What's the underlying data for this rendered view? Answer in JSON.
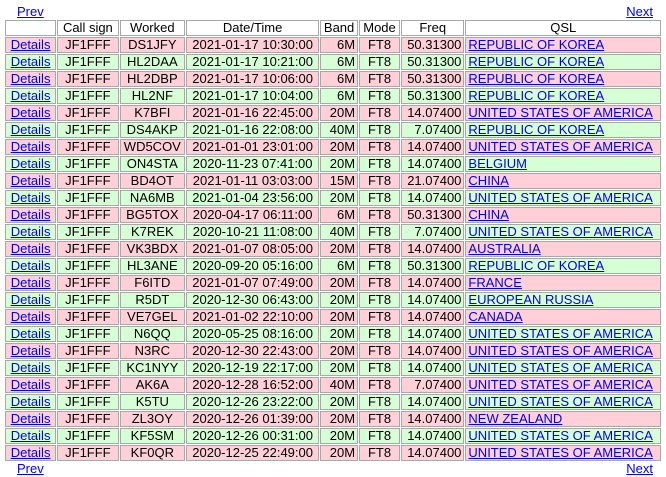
{
  "nav": {
    "prev_label": "Prev",
    "next_label": "Next"
  },
  "headers": [
    "",
    "Call sign",
    "Worked",
    "Date/Time",
    "Band",
    "Mode",
    "Freq",
    "QSL"
  ],
  "details_label": "Details",
  "row_colors": {
    "odd": "#ffd0d8",
    "even": "#d6ffd6"
  },
  "rows": [
    {
      "call": "JF1FFF",
      "worked": "DS1JFY",
      "datetime": "2021-01-17 10:30:00",
      "band": "6M",
      "mode": "FT8",
      "freq": "50.31300",
      "qsl": "REPUBLIC OF KOREA"
    },
    {
      "call": "JF1FFF",
      "worked": "HL2DAA",
      "datetime": "2021-01-17 10:21:00",
      "band": "6M",
      "mode": "FT8",
      "freq": "50.31300",
      "qsl": "REPUBLIC OF KOREA"
    },
    {
      "call": "JF1FFF",
      "worked": "HL2DBP",
      "datetime": "2021-01-17 10:06:00",
      "band": "6M",
      "mode": "FT8",
      "freq": "50.31300",
      "qsl": "REPUBLIC OF KOREA"
    },
    {
      "call": "JF1FFF",
      "worked": "HL2NF",
      "datetime": "2021-01-17 10:04:00",
      "band": "6M",
      "mode": "FT8",
      "freq": "50.31300",
      "qsl": "REPUBLIC OF KOREA"
    },
    {
      "call": "JF1FFF",
      "worked": "K7BFI",
      "datetime": "2021-01-16 22:45:00",
      "band": "20M",
      "mode": "FT8",
      "freq": "14.07400",
      "qsl": "UNITED STATES OF AMERICA"
    },
    {
      "call": "JF1FFF",
      "worked": "DS4AKP",
      "datetime": "2021-01-16 22:08:00",
      "band": "40M",
      "mode": "FT8",
      "freq": "7.07400",
      "qsl": "REPUBLIC OF KOREA"
    },
    {
      "call": "JF1FFF",
      "worked": "WD5COV",
      "datetime": "2021-01-01 23:01:00",
      "band": "20M",
      "mode": "FT8",
      "freq": "14.07400",
      "qsl": "UNITED STATES OF AMERICA"
    },
    {
      "call": "JF1FFF",
      "worked": "ON4STA",
      "datetime": "2020-11-23 07:41:00",
      "band": "20M",
      "mode": "FT8",
      "freq": "14.07400",
      "qsl": "BELGIUM"
    },
    {
      "call": "JF1FFF",
      "worked": "BD4OT",
      "datetime": "2021-01-11 03:03:00",
      "band": "15M",
      "mode": "FT8",
      "freq": "21.07400",
      "qsl": "CHINA"
    },
    {
      "call": "JF1FFF",
      "worked": "NA6MB",
      "datetime": "2021-01-04 23:56:00",
      "band": "20M",
      "mode": "FT8",
      "freq": "14.07400",
      "qsl": "UNITED STATES OF AMERICA"
    },
    {
      "call": "JF1FFF",
      "worked": "BG5TOX",
      "datetime": "2020-04-17 06:11:00",
      "band": "6M",
      "mode": "FT8",
      "freq": "50.31300",
      "qsl": "CHINA"
    },
    {
      "call": "JF1FFF",
      "worked": "K7REK",
      "datetime": "2020-10-21 11:08:00",
      "band": "40M",
      "mode": "FT8",
      "freq": "7.07400",
      "qsl": "UNITED STATES OF AMERICA"
    },
    {
      "call": "JF1FFF",
      "worked": "VK3BDX",
      "datetime": "2021-01-07 08:05:00",
      "band": "20M",
      "mode": "FT8",
      "freq": "14.07400",
      "qsl": "AUSTRALIA"
    },
    {
      "call": "JF1FFF",
      "worked": "HL3ANE",
      "datetime": "2020-09-20 05:16:00",
      "band": "6M",
      "mode": "FT8",
      "freq": "50.31300",
      "qsl": "REPUBLIC OF KOREA"
    },
    {
      "call": "JF1FFF",
      "worked": "F6ITD",
      "datetime": "2021-01-07 07:49:00",
      "band": "20M",
      "mode": "FT8",
      "freq": "14.07400",
      "qsl": "FRANCE"
    },
    {
      "call": "JF1FFF",
      "worked": "R5DT",
      "datetime": "2020-12-30 06:43:00",
      "band": "20M",
      "mode": "FT8",
      "freq": "14.07400",
      "qsl": "EUROPEAN RUSSIA"
    },
    {
      "call": "JF1FFF",
      "worked": "VE7GEL",
      "datetime": "2021-01-02 22:10:00",
      "band": "20M",
      "mode": "FT8",
      "freq": "14.07400",
      "qsl": "CANADA"
    },
    {
      "call": "JF1FFF",
      "worked": "N6QQ",
      "datetime": "2020-05-25 08:16:00",
      "band": "20M",
      "mode": "FT8",
      "freq": "14.07400",
      "qsl": "UNITED STATES OF AMERICA"
    },
    {
      "call": "JF1FFF",
      "worked": "N3RC",
      "datetime": "2020-12-30 22:43:00",
      "band": "20M",
      "mode": "FT8",
      "freq": "14.07400",
      "qsl": "UNITED STATES OF AMERICA"
    },
    {
      "call": "JF1FFF",
      "worked": "KC1NYY",
      "datetime": "2020-12-19 22:17:00",
      "band": "20M",
      "mode": "FT8",
      "freq": "14.07400",
      "qsl": "UNITED STATES OF AMERICA"
    },
    {
      "call": "JF1FFF",
      "worked": "AK6A",
      "datetime": "2020-12-28 16:52:00",
      "band": "40M",
      "mode": "FT8",
      "freq": "7.07400",
      "qsl": "UNITED STATES OF AMERICA"
    },
    {
      "call": "JF1FFF",
      "worked": "K5TU",
      "datetime": "2020-12-26 23:22:00",
      "band": "20M",
      "mode": "FT8",
      "freq": "14.07400",
      "qsl": "UNITED STATES OF AMERICA"
    },
    {
      "call": "JF1FFF",
      "worked": "ZL3OY",
      "datetime": "2020-12-26 01:39:00",
      "band": "20M",
      "mode": "FT8",
      "freq": "14.07400",
      "qsl": "NEW ZEALAND"
    },
    {
      "call": "JF1FFF",
      "worked": "KF5SM",
      "datetime": "2020-12-26 00:31:00",
      "band": "20M",
      "mode": "FT8",
      "freq": "14.07400",
      "qsl": "UNITED STATES OF AMERICA"
    },
    {
      "call": "JF1FFF",
      "worked": "KF0QR",
      "datetime": "2020-12-25 22:49:00",
      "band": "20M",
      "mode": "FT8",
      "freq": "14.07400",
      "qsl": "UNITED STATES OF AMERICA"
    }
  ]
}
